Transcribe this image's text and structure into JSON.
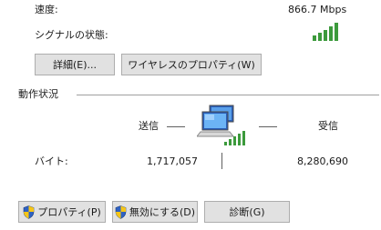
{
  "speed": {
    "label": "速度:",
    "value": "866.7 Mbps"
  },
  "signal": {
    "label": "シグナルの状態:",
    "bars": 5,
    "color": "#3c9a3c",
    "icon": "signal-strength-icon"
  },
  "buttons_top": {
    "details": "詳細(E)...",
    "wireless_properties": "ワイヤレスのプロパティ(W)"
  },
  "activity": {
    "section_title": "動作状況",
    "sent_label": "送信",
    "received_label": "受信",
    "bytes_label": "バイト:",
    "bytes_sent": "1,717,057",
    "bytes_received": "8,280,690",
    "icon": "network-computers-icon"
  },
  "buttons_bottom": {
    "properties": "プロパティ(P)",
    "disable": "無効にする(D)",
    "diagnose": "診断(G)",
    "shield_icon": "uac-shield-icon"
  }
}
